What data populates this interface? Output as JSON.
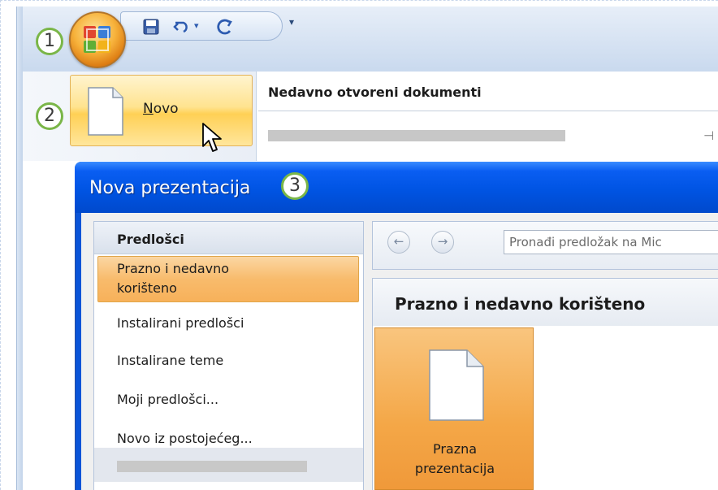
{
  "quick_access": {
    "save_icon": "save-icon",
    "undo_icon": "undo-icon",
    "redo_icon": "redo-icon",
    "customize_arrow": "▾"
  },
  "office_menu": {
    "new_item": {
      "label_underlined": "N",
      "label_rest": "ovo"
    },
    "recent_title": "Nedavno otvoreni dokumenti"
  },
  "callouts": [
    "1",
    "2",
    "3"
  ],
  "dialog": {
    "title": "Nova prezentacija",
    "templates": {
      "header": "Predlošci",
      "selected_line1": "Prazno i nedavno",
      "selected_line2": "korišteno",
      "items": [
        "Instalirani predlošci",
        "Instalirane teme",
        "Moji predlošci...",
        "Novo iz postojećeg..."
      ]
    },
    "nav": {
      "back": "←",
      "forward": "→"
    },
    "search_placeholder": "Pronađi predložak na Mic",
    "content_title": "Prazno i nedavno korišteno",
    "thumb_line1": "Prazna",
    "thumb_line2": "prezentacija"
  },
  "colors": {
    "callout_ring": "#7ab648",
    "dialog_title": "#0054e3",
    "selection": "#f8bb6c"
  }
}
